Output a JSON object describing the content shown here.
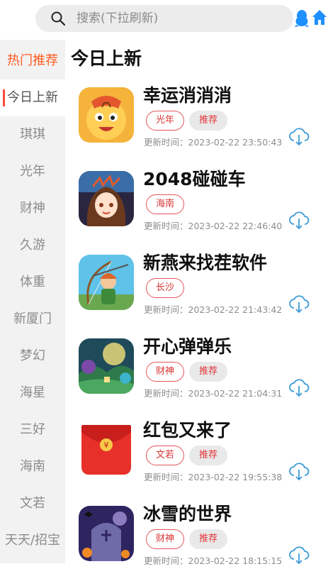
{
  "search": {
    "placeholder": "搜索(下拉刷新)"
  },
  "header_icons": {
    "qq": "qq-penguin-icon",
    "home": "home-icon"
  },
  "colors": {
    "accent": "#ff5a1f",
    "tag_border": "#e2565a",
    "tag_text": "#d73434",
    "download": "#3d9bd8"
  },
  "sidebar": {
    "items": [
      {
        "label": "热门推荐"
      },
      {
        "label": "今日上新"
      },
      {
        "label": "琪琪"
      },
      {
        "label": "光年"
      },
      {
        "label": "财神"
      },
      {
        "label": "久游"
      },
      {
        "label": "体重"
      },
      {
        "label": "新厦门"
      },
      {
        "label": "梦幻"
      },
      {
        "label": "海星"
      },
      {
        "label": "三好"
      },
      {
        "label": "海南"
      },
      {
        "label": "文若"
      },
      {
        "label": "天天/招宝"
      }
    ]
  },
  "main": {
    "title": "今日上新",
    "time_prefix": "更新时间：",
    "apps": [
      {
        "name": "幸运消消消",
        "tags": [
          "光年",
          "推荐"
        ],
        "time": "更新时间：2023-02-22 23:50:43",
        "icon": "tiger-game-icon"
      },
      {
        "name": "2048碰碰车",
        "tags": [
          "海南"
        ],
        "time": "更新时间：2023-02-22 22:46:40",
        "icon": "anime-girl-game-icon"
      },
      {
        "name": "新燕来找茬软件",
        "tags": [
          "长沙"
        ],
        "time": "更新时间：2023-02-22 21:43:42",
        "icon": "archer-game-icon"
      },
      {
        "name": "开心弹弹乐",
        "tags": [
          "财神",
          "推荐"
        ],
        "time": "更新时间：2023-02-22 21:04:31",
        "icon": "forest-game-icon"
      },
      {
        "name": "红包又来了",
        "tags": [
          "文若",
          "推荐"
        ],
        "time": "更新时间：2023-02-22 19:55:38",
        "icon": "red-envelope-icon"
      },
      {
        "name": "冰雪的世界",
        "tags": [
          "财神",
          "推荐"
        ],
        "time": "更新时间：2023-02-22 18:15:15",
        "icon": "halloween-game-icon"
      }
    ]
  }
}
